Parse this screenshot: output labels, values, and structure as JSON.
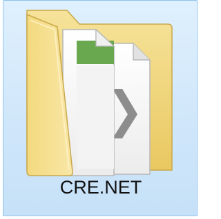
{
  "item": {
    "label": "CRE.NET",
    "icon": "folder-with-documents-icon",
    "selected": true
  },
  "colors": {
    "selection_fill": "#cfe6fa",
    "selection_border": "#8fc2ef",
    "folder_yellow": "#f2d77e",
    "document_accent_green": "#6aa84f"
  }
}
